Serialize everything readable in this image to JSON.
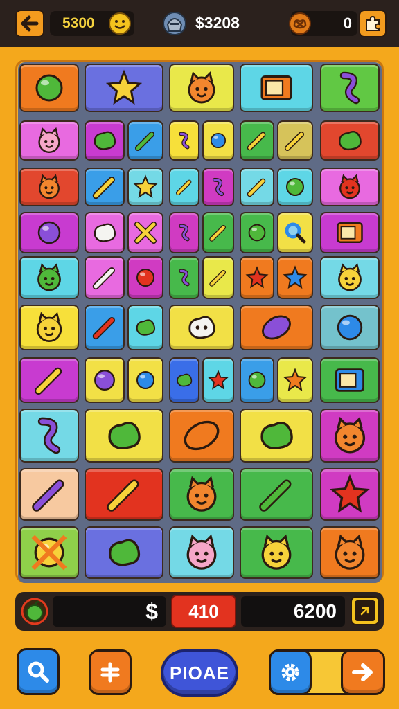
{
  "topbar": {
    "back_icon": "arrow-left-icon",
    "coins_value": "5300",
    "smiley_icon": "smiley-face-icon",
    "avatar_icon": "knight-avatar-icon",
    "cash_value": "$3208",
    "badge_icon": "pretzel-badge-icon",
    "score_value": "0",
    "puzzle_icon": "puzzle-piece-icon"
  },
  "colors": {
    "top_bar": "#2b211d",
    "frame": "#f4a81c",
    "board": "#5f6b86",
    "play_button": "#3f55d8",
    "red_counter": "#e2331f"
  },
  "board": {
    "tiles": [
      {
        "name": "football",
        "icon": "football-icon",
        "color": "#f07a1f"
      },
      {
        "name": "stars",
        "icon": "twin-stars-icon",
        "color": "#6a70e0"
      },
      {
        "name": "orange-cat",
        "icon": "orange-cat-icon",
        "color": "#e9e84a"
      },
      {
        "name": "retro-tv",
        "icon": "retro-tv-icon",
        "color": "#5ed6e6"
      },
      {
        "name": "green-teapot",
        "icon": "green-creature-icon",
        "color": "#61c844"
      },
      {
        "name": "pink-cat",
        "icon": "pink-cat-icon",
        "color": "#e86ae0"
      },
      {
        "name": "orange-blob",
        "icon": "orange-blob-icon",
        "color": "#c83bd0"
      },
      {
        "name": "green-ice",
        "icon": "ice-pop-icon",
        "color": "#3a9ee8"
      },
      {
        "name": "glyph",
        "icon": "glyph-icon",
        "color": "#f7e03a"
      },
      {
        "name": "blue-drop",
        "icon": "blue-drop-icon",
        "color": "#f2e046"
      },
      {
        "name": "yellow-pin",
        "icon": "pin-icon",
        "color": "#47b94b"
      },
      {
        "name": "hammer",
        "icon": "hammer-icon",
        "color": "#d6c35a"
      },
      {
        "name": "green-slime",
        "icon": "slime-icon",
        "color": "#e2472e"
      },
      {
        "name": "orange-cat-2",
        "icon": "orange-cat-icon",
        "color": "#e2472e"
      },
      {
        "name": "crayon",
        "icon": "crayon-icon",
        "color": "#3a9ee8"
      },
      {
        "name": "star",
        "icon": "star-icon",
        "color": "#74d9e6"
      },
      {
        "name": "cone",
        "icon": "cone-icon",
        "color": "#5ed6e6"
      },
      {
        "name": "hook",
        "icon": "hook-icon",
        "color": "#d03bc2"
      },
      {
        "name": "pencil",
        "icon": "pencil-icon",
        "color": "#74d9e6"
      },
      {
        "name": "grape-ball",
        "icon": "ball-icon",
        "color": "#5ed6e6"
      },
      {
        "name": "red-cat",
        "icon": "red-cat-icon",
        "color": "#e86ae0"
      },
      {
        "name": "purple-ball",
        "icon": "purple-ball-icon",
        "color": "#c83bd0"
      },
      {
        "name": "cloud",
        "icon": "cloud-icon",
        "color": "#e86ae0"
      },
      {
        "name": "cross",
        "icon": "cross-icon",
        "color": "#e86ae0"
      },
      {
        "name": "one",
        "icon": "one-icon",
        "color": "#d03bc2"
      },
      {
        "name": "green-pen",
        "icon": "pen-icon",
        "color": "#47b94b"
      },
      {
        "name": "spinning-top",
        "icon": "top-icon",
        "color": "#47b94b"
      },
      {
        "name": "magnifier",
        "icon": "magnifier-icon",
        "color": "#f2e046"
      },
      {
        "name": "crate",
        "icon": "crate-icon",
        "color": "#c83bd0"
      },
      {
        "name": "green-bear",
        "icon": "green-bear-icon",
        "color": "#5ed6e6"
      },
      {
        "name": "bone",
        "icon": "bone-icon",
        "color": "#e86ae0"
      },
      {
        "name": "red-ball",
        "icon": "red-ball-icon",
        "color": "#d03bc2"
      },
      {
        "name": "swirl",
        "icon": "swirl-icon",
        "color": "#47b94b"
      },
      {
        "name": "corn",
        "icon": "corn-icon",
        "color": "#e9e84a"
      },
      {
        "name": "orange-splat",
        "icon": "splat-icon",
        "color": "#f07a1f"
      },
      {
        "name": "blue-star",
        "icon": "blue-star-icon",
        "color": "#f07a1f"
      },
      {
        "name": "yellow-bear",
        "icon": "yellow-bear-icon",
        "color": "#74d9e6"
      },
      {
        "name": "yellow-cat",
        "icon": "yellow-cat-icon",
        "color": "#f7e03a"
      },
      {
        "name": "red-feather",
        "icon": "feather-icon",
        "color": "#3a9ee8"
      },
      {
        "name": "green-urchin",
        "icon": "urchin-icon",
        "color": "#5ed6e6"
      },
      {
        "name": "ghost",
        "icon": "ghost-icon",
        "color": "#f2e046"
      },
      {
        "name": "kite",
        "icon": "kite-icon",
        "color": "#f07a1f"
      },
      {
        "name": "dropper",
        "icon": "dropper-icon",
        "color": "#74c2cc"
      },
      {
        "name": "wand",
        "icon": "wand-icon",
        "color": "#c83bd0"
      },
      {
        "name": "plum",
        "icon": "plum-icon",
        "color": "#f2e046"
      },
      {
        "name": "berries",
        "icon": "berries-icon",
        "color": "#f2e046"
      },
      {
        "name": "green-urchin-2",
        "icon": "urchin-icon",
        "color": "#3a6ee8"
      },
      {
        "name": "red-star",
        "icon": "red-star-icon",
        "color": "#5ed6e6"
      },
      {
        "name": "red-balloon",
        "icon": "balloon-icon",
        "color": "#3a9ee8"
      },
      {
        "name": "orange-sun",
        "icon": "sun-icon",
        "color": "#e9e84a"
      },
      {
        "name": "map",
        "icon": "map-icon",
        "color": "#47b94b"
      },
      {
        "name": "tomato",
        "icon": "tomato-icon",
        "color": "#74d9e6"
      },
      {
        "name": "turtle",
        "icon": "turtle-icon",
        "color": "#f2e046"
      },
      {
        "name": "pretzel",
        "icon": "pretzel-icon",
        "color": "#f07a1f"
      },
      {
        "name": "turtle-2",
        "icon": "turtle-icon",
        "color": "#f2e046"
      },
      {
        "name": "cat-face",
        "icon": "cat-face-icon",
        "color": "#d03bc2"
      },
      {
        "name": "syringe",
        "icon": "syringe-icon",
        "color": "#f7c9a0"
      },
      {
        "name": "bottle-brush",
        "icon": "bottle-brush-icon",
        "color": "#e2331f"
      },
      {
        "name": "pig",
        "icon": "pig-icon",
        "color": "#47b94b"
      },
      {
        "name": "brush-device",
        "icon": "brush-device-icon",
        "color": "#47b94b"
      },
      {
        "name": "green-splat",
        "icon": "green-splat-icon",
        "color": "#d03bc2"
      },
      {
        "name": "x-ball",
        "icon": "x-ball-icon",
        "color": "#8fd04a"
      },
      {
        "name": "green-blob",
        "icon": "green-blob-icon",
        "color": "#6a70e0"
      },
      {
        "name": "pink-pig",
        "icon": "pink-pig-icon",
        "color": "#74d9e6"
      },
      {
        "name": "smile-jug",
        "icon": "smile-jug-icon",
        "color": "#47b94b"
      },
      {
        "name": "orange-bear",
        "icon": "orange-bear-icon",
        "color": "#f07a1f"
      }
    ]
  },
  "bottom_bar": {
    "apple_icon": "green-apple-icon",
    "currency_text": "$",
    "counter_value": "410",
    "score_text": "6200",
    "arrow_icon": "diagonal-arrow-icon"
  },
  "controls": {
    "search_icon": "search-icon",
    "plus_icon": "plus-icon",
    "play_label": "PIOAE",
    "settings_icon": "gear-icon",
    "next_icon": "arrow-right-icon"
  }
}
